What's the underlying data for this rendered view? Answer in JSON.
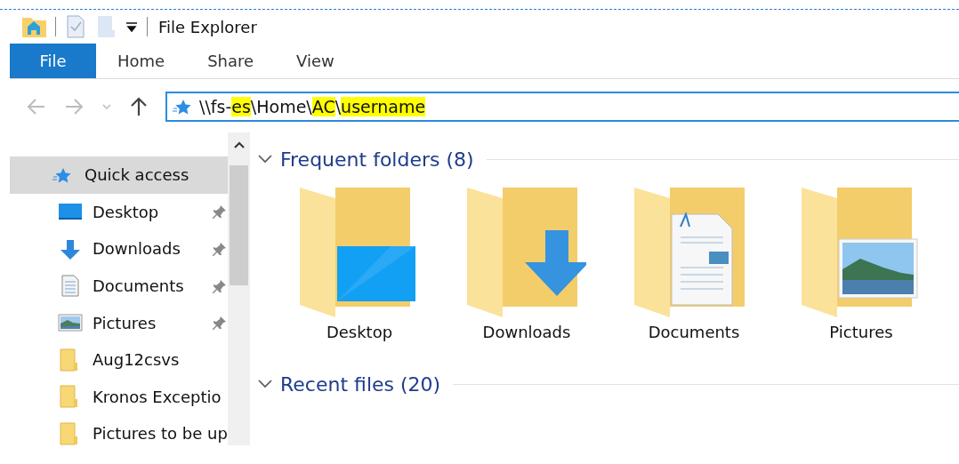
{
  "window": {
    "title": "File Explorer"
  },
  "ribbon_tabs": [
    {
      "label": "File",
      "selected": true
    },
    {
      "label": "Home",
      "selected": false
    },
    {
      "label": "Share",
      "selected": false
    },
    {
      "label": "View",
      "selected": false
    }
  ],
  "address": {
    "segments": [
      {
        "text": "\\\\fs-",
        "highlighted": false
      },
      {
        "text": "es",
        "highlighted": true
      },
      {
        "text": "\\Home\\",
        "highlighted": false
      },
      {
        "text": "AC",
        "highlighted": true
      },
      {
        "text": "\\",
        "highlighted": false
      },
      {
        "text": "username",
        "highlighted": true
      }
    ]
  },
  "sidebar": {
    "items": [
      {
        "label": "Quick access",
        "kind": "quick",
        "pinned": false,
        "selected": true
      },
      {
        "label": "Desktop",
        "kind": "desktop",
        "pinned": true,
        "selected": false
      },
      {
        "label": "Downloads",
        "kind": "downloads",
        "pinned": true,
        "selected": false
      },
      {
        "label": "Documents",
        "kind": "documents",
        "pinned": true,
        "selected": false
      },
      {
        "label": "Pictures",
        "kind": "pictures",
        "pinned": true,
        "selected": false
      },
      {
        "label": "Aug12csvs",
        "kind": "folder",
        "pinned": false,
        "selected": false
      },
      {
        "label": "Kronos Exceptio",
        "kind": "folder",
        "pinned": false,
        "selected": false
      },
      {
        "label": "Pictures to be up",
        "kind": "folder",
        "pinned": false,
        "selected": false
      }
    ]
  },
  "sections": [
    {
      "title": "Frequent folders (8)",
      "expanded": true,
      "folders": [
        {
          "label": "Desktop",
          "kind": "desktop"
        },
        {
          "label": "Downloads",
          "kind": "downloads"
        },
        {
          "label": "Documents",
          "kind": "documents"
        },
        {
          "label": "Pictures",
          "kind": "pictures"
        }
      ]
    },
    {
      "title": "Recent files (20)",
      "expanded": true
    }
  ]
}
